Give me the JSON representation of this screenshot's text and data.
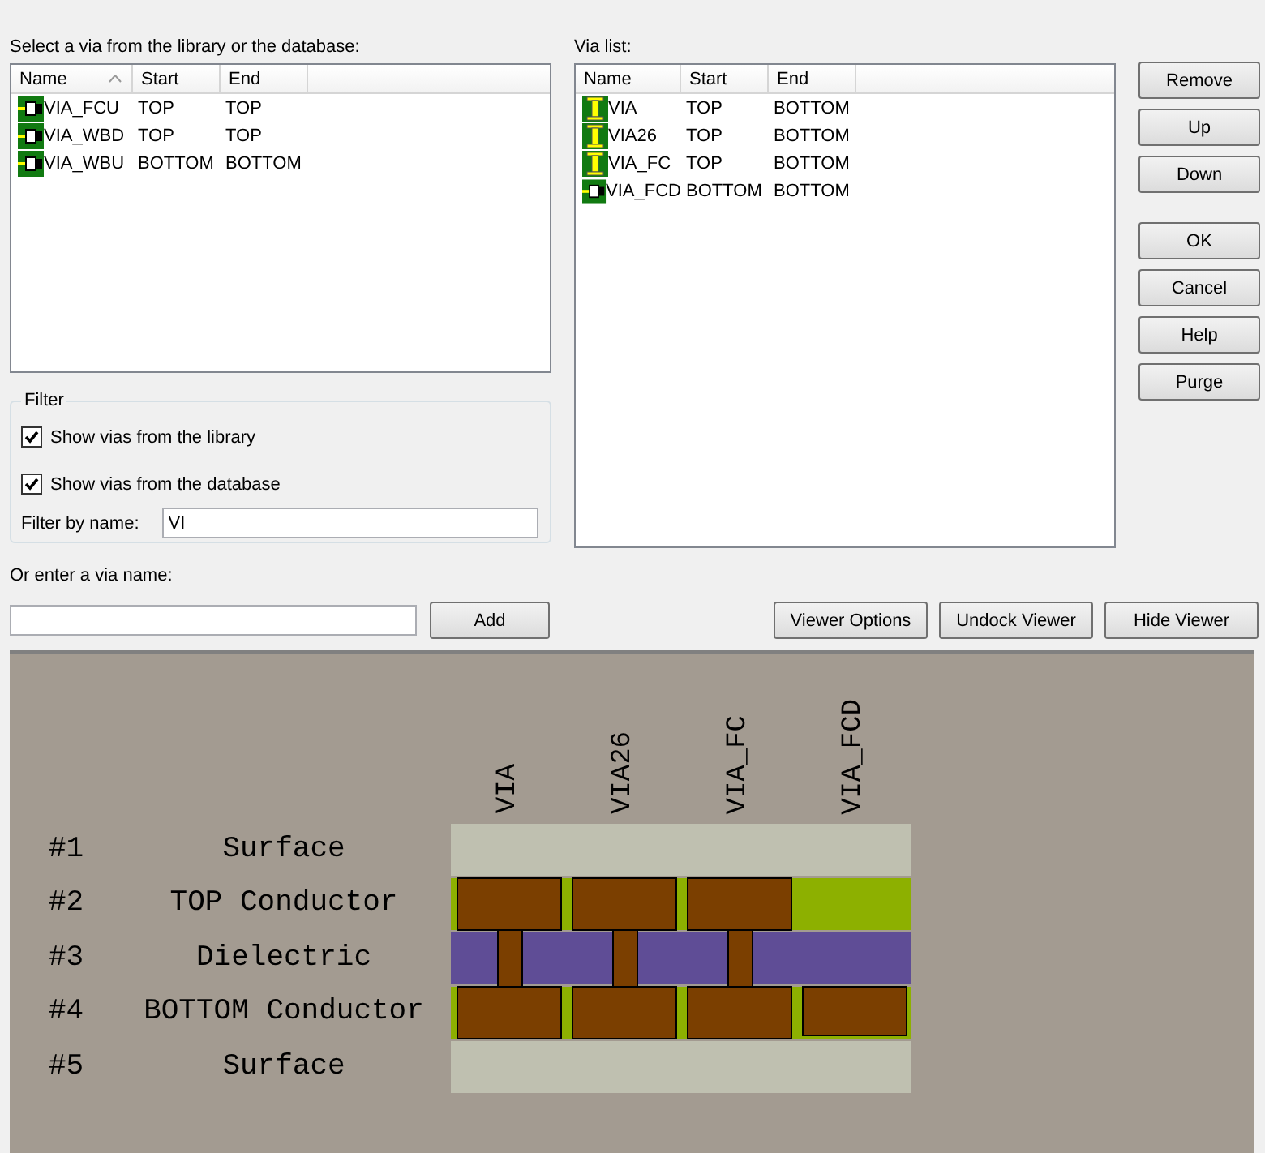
{
  "library": {
    "caption": "Select a via from the library or the database:",
    "columns": [
      {
        "label": "Name",
        "sorted": true
      },
      {
        "label": "Start",
        "sorted": false
      },
      {
        "label": "End",
        "sorted": false
      }
    ],
    "rows": [
      {
        "kind": "blind",
        "name": "VIA_FCU",
        "start": "TOP",
        "end": "TOP"
      },
      {
        "kind": "blind",
        "name": "VIA_WBD",
        "start": "TOP",
        "end": "TOP"
      },
      {
        "kind": "blind",
        "name": "VIA_WBU",
        "start": "BOTTOM",
        "end": "BOTTOM"
      }
    ]
  },
  "via_list": {
    "caption": "Via list:",
    "columns": [
      {
        "label": "Name",
        "sorted": false
      },
      {
        "label": "Start",
        "sorted": false
      },
      {
        "label": "End",
        "sorted": false
      }
    ],
    "rows": [
      {
        "kind": "through",
        "name": "VIA",
        "start": "TOP",
        "end": "BOTTOM"
      },
      {
        "kind": "through",
        "name": "VIA26",
        "start": "TOP",
        "end": "BOTTOM"
      },
      {
        "kind": "through",
        "name": "VIA_FC",
        "start": "TOP",
        "end": "BOTTOM"
      },
      {
        "kind": "blind",
        "name": "VIA_FCD",
        "start": "BOTTOM",
        "end": "BOTTOM"
      }
    ]
  },
  "side_buttons": [
    [
      "Remove",
      "Up",
      "Down"
    ],
    [
      "OK",
      "Cancel",
      "Help",
      "Purge"
    ]
  ],
  "filter": {
    "title": "Filter",
    "options": [
      {
        "label": "Show vias from the library",
        "checked": true
      },
      {
        "label": "Show vias from the database",
        "checked": true
      }
    ],
    "name_label": "Filter by name:",
    "name_value": "VI"
  },
  "enter": {
    "label": "Or enter a via name:",
    "add_button": "Add"
  },
  "viewer_buttons": [
    "Viewer Options",
    "Undock Viewer",
    "Hide Viewer"
  ],
  "viewer": {
    "vias": [
      {
        "label": "VIA",
        "kind": "through"
      },
      {
        "label": "VIA26",
        "kind": "through"
      },
      {
        "label": "VIA_FC",
        "kind": "through"
      },
      {
        "label": "VIA_FCD",
        "kind": "bottom"
      }
    ],
    "layers": [
      {
        "number": "#1",
        "name": "Surface",
        "kind": "surface"
      },
      {
        "number": "#2",
        "name": "TOP Conductor",
        "kind": "conductor"
      },
      {
        "number": "#3",
        "name": "Dielectric",
        "kind": "dielectric"
      },
      {
        "number": "#4",
        "name": "BOTTOM Conductor",
        "kind": "conductor"
      },
      {
        "number": "#5",
        "name": "Surface",
        "kind": "surface"
      }
    ]
  }
}
